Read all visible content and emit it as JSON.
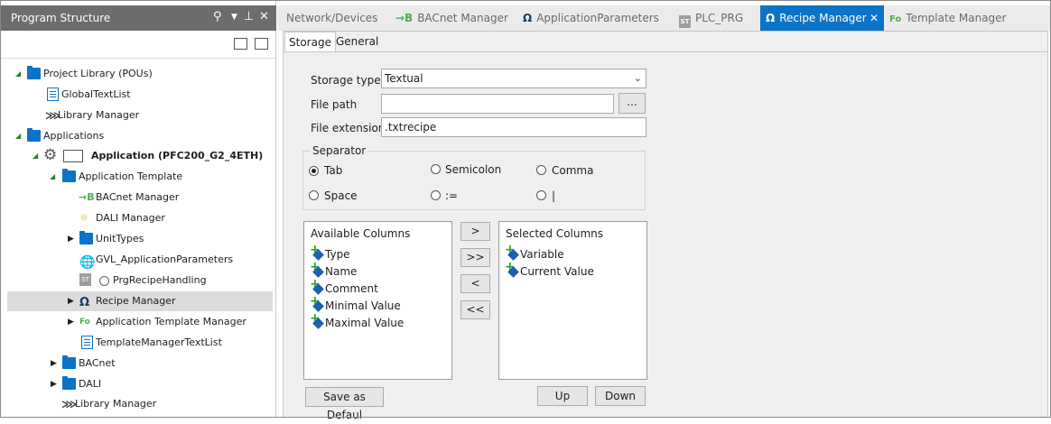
{
  "left_panel": {
    "title": "Program Structure",
    "header_icons": [
      "search-icon",
      "chevron-down-icon",
      "pin-icon",
      "close-icon"
    ],
    "toolbar_icons": [
      "expand-all-icon",
      "collapse-all-icon"
    ],
    "tree": [
      {
        "label": "Project Library (POUs)",
        "icon": "library-icon",
        "expanded": true
      },
      {
        "label": "GlobalTextList",
        "icon": "text-list-icon"
      },
      {
        "label": "Library Manager",
        "icon": "library-manager-icon"
      },
      {
        "label": "Applications",
        "icon": "applications-icon",
        "expanded": true
      },
      {
        "label": "Application (PFC200_G2_4ETH)",
        "icon": "gear-icon",
        "expanded": true
      },
      {
        "label": "Application Template",
        "icon": "folder-icon",
        "expanded": true
      },
      {
        "label": "BACnet Manager",
        "icon": "bacnet-icon"
      },
      {
        "label": "DALI Manager",
        "icon": "dali-icon"
      },
      {
        "label": "UnitTypes",
        "icon": "folder-icon",
        "expanded": false
      },
      {
        "label": "GVL_ApplicationParameters",
        "icon": "globe-icon"
      },
      {
        "label": "PrgRecipeHandling",
        "icon": "program-icon"
      },
      {
        "label": "Recipe Manager",
        "icon": "recipe-manager-icon",
        "expanded": false,
        "selected": true
      },
      {
        "label": "Application Template Manager",
        "icon": "template-manager-icon",
        "expanded": false
      },
      {
        "label": "TemplateManagerTextList",
        "icon": "text-list-icon"
      },
      {
        "label": "BACnet",
        "icon": "folder-icon",
        "expanded": false
      },
      {
        "label": "DALI",
        "icon": "folder-icon",
        "expanded": false
      },
      {
        "label": "Library Manager",
        "icon": "library-manager-icon"
      }
    ]
  },
  "tabs": [
    {
      "label": "Network/Devices",
      "icon": ""
    },
    {
      "label": "BACnet Manager",
      "icon": "bacnet-icon"
    },
    {
      "label": "ApplicationParameters",
      "icon": "application-parameters-icon"
    },
    {
      "label": "PLC_PRG",
      "icon": "program-icon"
    },
    {
      "label": "Recipe Manager",
      "icon": "recipe-manager-icon",
      "active": true,
      "close_icon": "close-icon"
    },
    {
      "label": "Template Manager",
      "icon": "template-manager-icon"
    }
  ],
  "sub_tabs": [
    {
      "label": "Storage",
      "active": true
    },
    {
      "label": "General"
    }
  ],
  "storage": {
    "storage_type_label": "Storage type",
    "storage_type_value": "Textual",
    "file_path_label": "File path",
    "file_path_value": "",
    "browse_label": "...",
    "file_extension_label": "File extension",
    "file_extension_value": ".txtrecipe",
    "separator_label": "Separator",
    "separators": [
      {
        "label": "Tab",
        "selected": true
      },
      {
        "label": "Semicolon",
        "selected": false
      },
      {
        "label": "Comma",
        "selected": false
      },
      {
        "label": "Space",
        "selected": false
      },
      {
        "label": ":=",
        "selected": false
      },
      {
        "label": "|",
        "selected": false
      }
    ],
    "available_columns_title": "Available Columns",
    "available_columns": [
      "Type",
      "Name",
      "Comment",
      "Minimal Value",
      "Maximal Value"
    ],
    "selected_columns_title": "Selected Columns",
    "selected_columns": [
      "Variable",
      "Current Value"
    ],
    "move_buttons": [
      ">",
      ">>",
      "<",
      "<<"
    ],
    "save_default_label": "Save as Defaul",
    "up_label": "Up",
    "down_label": "Down"
  }
}
